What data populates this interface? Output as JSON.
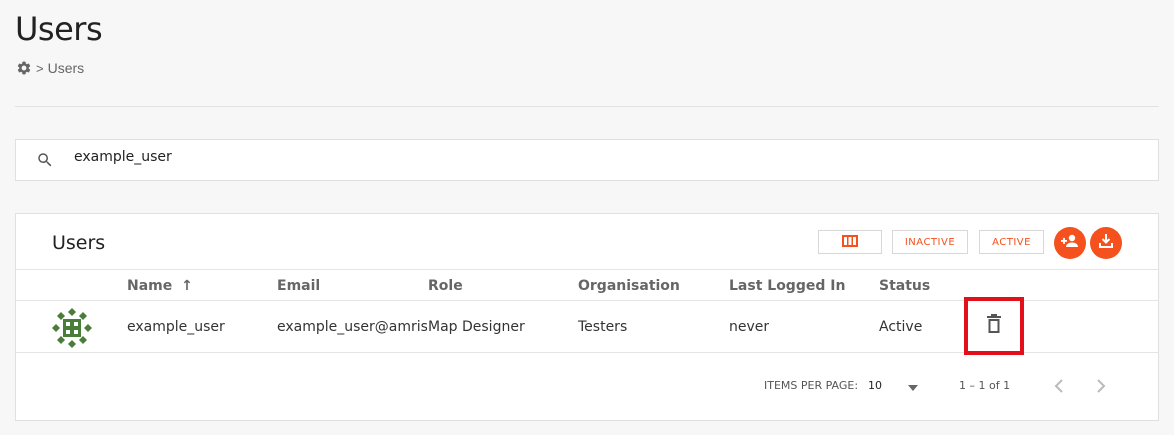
{
  "page": {
    "title": "Users",
    "breadcrumb": {
      "icon": "gear-icon",
      "separator": ">",
      "current": "Users"
    }
  },
  "search": {
    "icon": "search-icon",
    "value": "example_user"
  },
  "users_card": {
    "title": "Users",
    "toolbar": {
      "columns_icon": "columns-icon",
      "inactive_label": "INACTIVE",
      "active_label": "ACTIVE",
      "add_user_icon": "add-user-icon",
      "download_icon": "download-icon"
    },
    "columns": [
      "Name",
      "Email",
      "Role",
      "Organisation",
      "Last Logged In",
      "Status"
    ],
    "sort_indicator": "↑",
    "rows": [
      {
        "name": "example_user",
        "email": "example_user@amrista",
        "role": "Map Designer",
        "organisation": "Testers",
        "last_logged_in": "never",
        "status": "Active"
      }
    ],
    "pagination": {
      "items_per_page_label": "ITEMS PER PAGE:",
      "items_per_page_value": "10",
      "range": "1 – 1 of 1"
    }
  },
  "colors": {
    "accent": "#f4511e",
    "highlight": "#e3101b",
    "avatar": "#4a7d3a"
  }
}
